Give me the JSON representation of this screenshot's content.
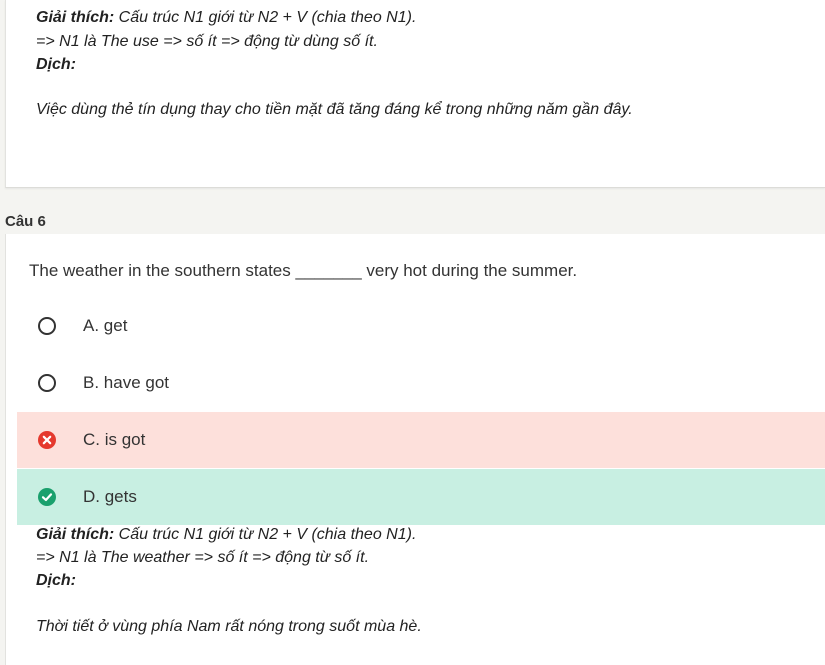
{
  "previous_explanation": {
    "label": "Giải thích:",
    "text": " Cấu trúc N1 giới từ N2 + V (chia theo N1).",
    "line2": "=> N1 là The use => số ít => động từ dùng số ít.",
    "translate_label": "Dịch:",
    "translation": "Việc dùng thẻ tín dụng thay cho tiền mặt đã tăng đáng kể trong những năm gần đây."
  },
  "question": {
    "label": "Câu 6",
    "text": "The weather in the southern states _______ very hot during the summer.",
    "options": [
      {
        "label": "A. get",
        "state": "unselected"
      },
      {
        "label": "B. have got",
        "state": "unselected"
      },
      {
        "label": "C. is got",
        "state": "wrong"
      },
      {
        "label": "D. gets",
        "state": "correct"
      }
    ],
    "explanation": {
      "label": "Giải thích:",
      "text": " Cấu trúc N1 giới từ N2 + V (chia theo N1).",
      "line2": "=> N1 là The weather => số ít => động từ số ít.",
      "translate_label": "Dịch:",
      "translation": "Thời tiết ở vùng phía Nam rất nóng trong suốt mùa hè."
    }
  },
  "colors": {
    "wrong_bg": "#fde0db",
    "correct_bg": "#c8efe2",
    "wrong_icon": "#e5392e",
    "correct_icon": "#1aa06d"
  }
}
